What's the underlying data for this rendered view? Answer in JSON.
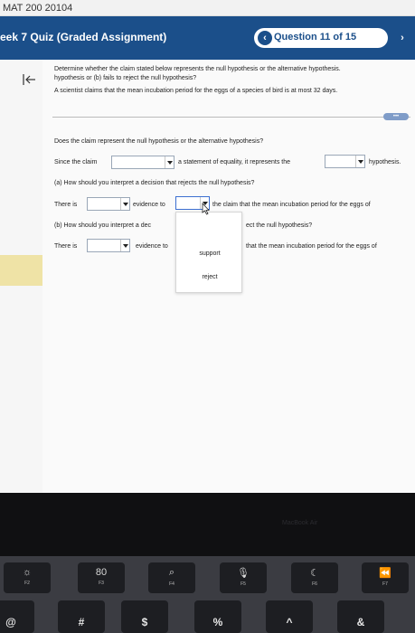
{
  "topbar": {
    "course": "MAT 200 20104"
  },
  "header": {
    "title": "eek 7 Quiz (Graded Assignment)",
    "question_counter": "Question 11 of 15",
    "prev_glyph": "‹",
    "next_glyph": "›"
  },
  "prompt": {
    "line1": "Determine whether the claim stated below represents the null hypothesis or the alternative hypothesis.",
    "line2": "hypothesis or (b) fails to reject the null hypothesis?",
    "claim": "A scientist claims that the mean incubation period for the eggs of a species of bird is at most 32 days."
  },
  "more_label": "•••",
  "questions": {
    "q1": "Does the claim represent the null hypothesis or the alternative hypothesis?",
    "since_prefix": "Since the claim",
    "since_middle": "a statement of equality, it represents the",
    "since_suffix": "hypothesis.",
    "a_label": "(a) How should you interpret a decision that rejects the null hypothesis?",
    "there_is_1": "There is",
    "evidence_to_1": "evidence to",
    "a_tail": "the claim that the mean incubation period for the eggs of",
    "b_label_left": "(b) How should you interpret a dec",
    "b_label_right": "ect the null hypothesis?",
    "there_is_2": "There is",
    "evidence_to_2": "evidence to",
    "b_tail": "that the mean incubation period for the eggs of"
  },
  "dropdown_menu": {
    "options": [
      "support",
      "reject"
    ]
  },
  "bezel_label": "MacBook Air",
  "function_keys": [
    {
      "glyph": "☼",
      "label": "F2"
    },
    {
      "glyph": "80",
      "label": "F3"
    },
    {
      "glyph": "⌕",
      "label": "F4"
    },
    {
      "glyph": "🎙",
      "label": "F5"
    },
    {
      "glyph": "☾",
      "label": "F6"
    },
    {
      "glyph": "⏪",
      "label": "F7"
    }
  ],
  "number_keys": [
    "@",
    "#",
    "$",
    "%",
    "^",
    "&"
  ]
}
